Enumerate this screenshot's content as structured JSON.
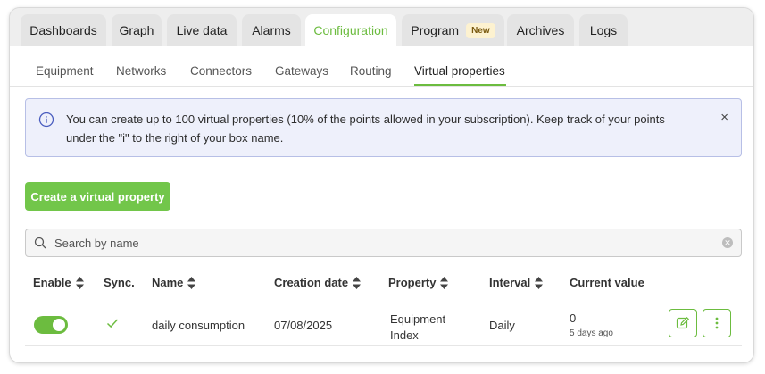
{
  "tabs": [
    {
      "label": "Dashboards"
    },
    {
      "label": "Graph"
    },
    {
      "label": "Live data"
    },
    {
      "label": "Alarms"
    },
    {
      "label": "Configuration",
      "active": true
    },
    {
      "label": "Program",
      "badge": "New"
    },
    {
      "label": "Archives"
    },
    {
      "label": "Logs"
    }
  ],
  "subtabs": [
    {
      "label": "Equipment"
    },
    {
      "label": "Networks"
    },
    {
      "label": "Connectors"
    },
    {
      "label": "Gateways"
    },
    {
      "label": "Routing"
    },
    {
      "label": "Virtual properties",
      "active": true
    }
  ],
  "alert": {
    "text": "You can create up to 100 virtual properties (10% of the points allowed in your subscription). Keep track of your points under the \"i\" to the right of your box name.",
    "close_label": "×"
  },
  "create_button": "Create a virtual property",
  "search": {
    "placeholder": "Search by name"
  },
  "table": {
    "headers": {
      "enable": "Enable",
      "sync": "Sync.",
      "name": "Name",
      "creation_date": "Creation date",
      "property": "Property",
      "interval": "Interval",
      "current_value": "Current value"
    },
    "rows": [
      {
        "enabled": true,
        "synced": true,
        "name": "daily consumption",
        "creation_date": "07/08/2025",
        "property": "Equipment Index",
        "interval": "Daily",
        "current_value": "0",
        "current_value_age": "5 days ago"
      }
    ]
  },
  "colors": {
    "accent": "#6cbc3f",
    "alert_bg": "#eef0fb",
    "alert_border": "#b7bfe6",
    "badge_bg": "#fdf2d0"
  }
}
